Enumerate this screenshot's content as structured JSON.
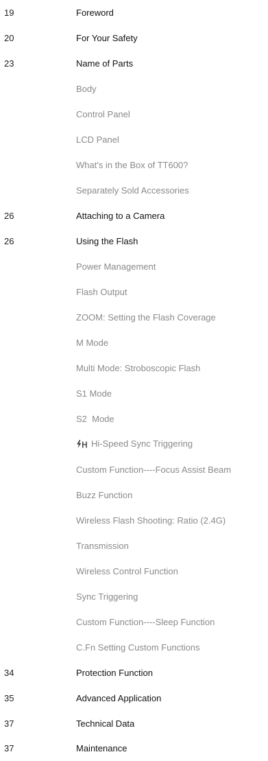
{
  "toc": {
    "entries": [
      {
        "page": "19",
        "title": "Foreword",
        "level": 1
      },
      {
        "page": "20",
        "title": "For Your Safety",
        "level": 1
      },
      {
        "page": "23",
        "title": "Name of Parts",
        "level": 1
      },
      {
        "page": "",
        "title": "Body",
        "level": 2
      },
      {
        "page": "",
        "title": "Control Panel",
        "level": 2
      },
      {
        "page": "",
        "title": "LCD Panel",
        "level": 2
      },
      {
        "page": "",
        "title": "What's in the Box of TT600?",
        "level": 2
      },
      {
        "page": "",
        "title": "Separately Sold Accessories",
        "level": 2
      },
      {
        "page": "26",
        "title": "Attaching to a Camera",
        "level": 1
      },
      {
        "page": "26",
        "title": "Using the Flash",
        "level": 1
      },
      {
        "page": "",
        "title": "Power Management",
        "level": 2
      },
      {
        "page": "",
        "title": "Flash Output",
        "level": 2
      },
      {
        "page": "",
        "title": "ZOOM: Setting the Flash Coverage",
        "level": 2
      },
      {
        "page": "",
        "title": "M Mode",
        "level": 2
      },
      {
        "page": "",
        "title": "Multi Mode: Stroboscopic Flash",
        "level": 2
      },
      {
        "page": "",
        "title": "S1 Mode",
        "level": 2
      },
      {
        "page": "",
        "title": "S2  Mode",
        "level": 2
      },
      {
        "page": "",
        "title": "Hi-Speed Sync Triggering",
        "level": 2,
        "icon": "high-speed-sync-icon"
      },
      {
        "page": "",
        "title": "Custom Function----Focus Assist Beam",
        "level": 2
      },
      {
        "page": "",
        "title": "Buzz Function",
        "level": 2
      },
      {
        "page": "",
        "title": "Wireless Flash Shooting: Ratio (2.4G)",
        "level": 2
      },
      {
        "page": "",
        "title": "Transmission",
        "level": 2
      },
      {
        "page": "",
        "title": "Wireless Control Function",
        "level": 2
      },
      {
        "page": "",
        "title": "Sync Triggering",
        "level": 2
      },
      {
        "page": "",
        "title": "Custom Function----Sleep Function",
        "level": 2
      },
      {
        "page": "",
        "title": "C.Fn Setting Custom Functions",
        "level": 2
      },
      {
        "page": "34",
        "title": "Protection Function",
        "level": 1
      },
      {
        "page": "35",
        "title": "Advanced Application",
        "level": 1
      },
      {
        "page": "37",
        "title": "Technical Data",
        "level": 1
      },
      {
        "page": "37",
        "title": "Maintenance",
        "level": 1
      }
    ]
  }
}
